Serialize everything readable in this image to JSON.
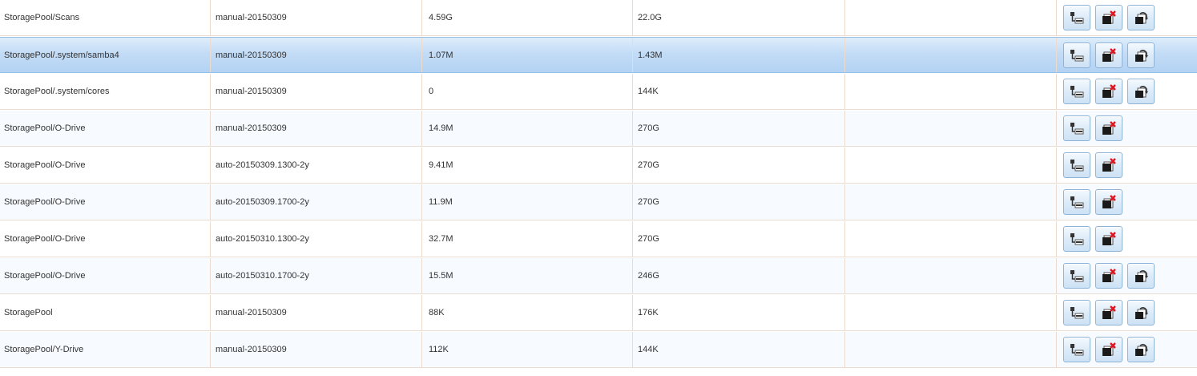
{
  "table": {
    "rows": [
      {
        "filesystem": "StoragePool/Scans",
        "snapshot": "manual-20150309",
        "used": "4.59G",
        "refer": "22.0G",
        "extra": "",
        "actions": [
          "clone",
          "delete",
          "rollback"
        ],
        "selected": false
      },
      {
        "filesystem": "StoragePool/.system/samba4",
        "snapshot": "manual-20150309",
        "used": "1.07M",
        "refer": "1.43M",
        "extra": "",
        "actions": [
          "clone",
          "delete",
          "rollback"
        ],
        "selected": true
      },
      {
        "filesystem": "StoragePool/.system/cores",
        "snapshot": "manual-20150309",
        "used": "0",
        "refer": "144K",
        "extra": "",
        "actions": [
          "clone",
          "delete",
          "rollback"
        ],
        "selected": false
      },
      {
        "filesystem": "StoragePool/O-Drive",
        "snapshot": "manual-20150309",
        "used": "14.9M",
        "refer": "270G",
        "extra": "",
        "actions": [
          "clone",
          "delete"
        ],
        "selected": false
      },
      {
        "filesystem": "StoragePool/O-Drive",
        "snapshot": "auto-20150309.1300-2y",
        "used": "9.41M",
        "refer": "270G",
        "extra": "",
        "actions": [
          "clone",
          "delete"
        ],
        "selected": false
      },
      {
        "filesystem": "StoragePool/O-Drive",
        "snapshot": "auto-20150309.1700-2y",
        "used": "11.9M",
        "refer": "270G",
        "extra": "",
        "actions": [
          "clone",
          "delete"
        ],
        "selected": false
      },
      {
        "filesystem": "StoragePool/O-Drive",
        "snapshot": "auto-20150310.1300-2y",
        "used": "32.7M",
        "refer": "270G",
        "extra": "",
        "actions": [
          "clone",
          "delete"
        ],
        "selected": false
      },
      {
        "filesystem": "StoragePool/O-Drive",
        "snapshot": "auto-20150310.1700-2y",
        "used": "15.5M",
        "refer": "246G",
        "extra": "",
        "actions": [
          "clone",
          "delete",
          "rollback"
        ],
        "selected": false
      },
      {
        "filesystem": "StoragePool",
        "snapshot": "manual-20150309",
        "used": "88K",
        "refer": "176K",
        "extra": "",
        "actions": [
          "clone",
          "delete",
          "rollback"
        ],
        "selected": false
      },
      {
        "filesystem": "StoragePool/Y-Drive",
        "snapshot": "manual-20150309",
        "used": "112K",
        "refer": "144K",
        "extra": "",
        "actions": [
          "clone",
          "delete",
          "rollback"
        ],
        "selected": false
      }
    ]
  },
  "icons": {
    "clone": "clone-snapshot-icon",
    "delete": "delete-snapshot-icon",
    "rollback": "rollback-snapshot-icon"
  },
  "colors": {
    "selected_row": "#c3dcf6",
    "delete_mark": "#e0141e",
    "button_border": "#8fb3d6"
  }
}
